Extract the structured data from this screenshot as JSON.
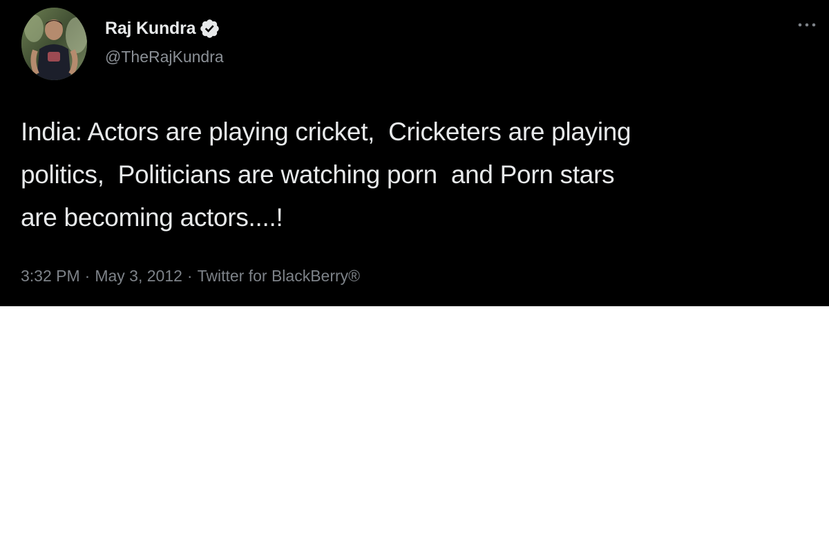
{
  "tweet": {
    "author": {
      "display_name": "Raj Kundra",
      "handle": "@TheRajKundra",
      "verified": true
    },
    "text": "India: Actors are playing cricket,  Cricketers are playing\npolitics,  Politicians are watching porn  and Porn stars\nare becoming actors....!",
    "meta": {
      "time": "3:32 PM",
      "date": "May 3, 2012",
      "source": "Twitter for BlackBerry®",
      "separator": "·"
    },
    "icons": {
      "verified": "verified-badge-icon",
      "more": "more-options-icon"
    }
  },
  "colors": {
    "card_background": "#000000",
    "page_background": "#ffffff",
    "primary_text": "#e7e9ea",
    "secondary_text": "#8b9096"
  }
}
